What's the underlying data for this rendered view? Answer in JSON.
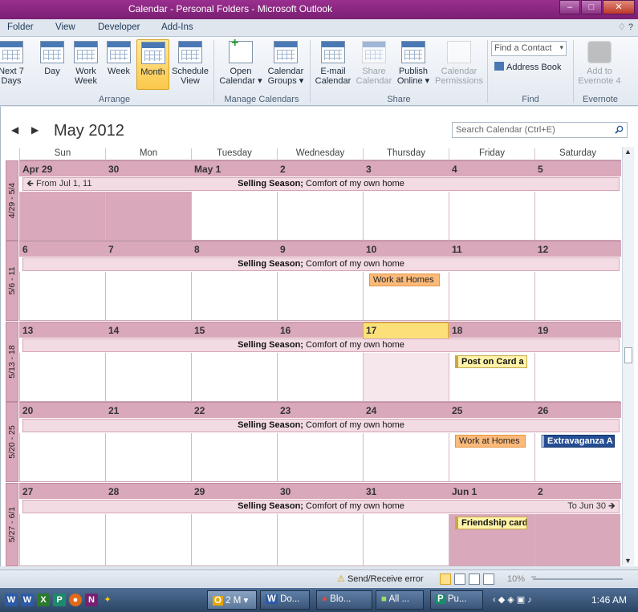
{
  "window": {
    "title": "Calendar - Personal Folders - Microsoft Outlook",
    "min": "–",
    "max": "□",
    "close": "✕"
  },
  "tabs": [
    "Folder",
    "View",
    "Developer",
    "Add-Ins"
  ],
  "tabs_right": "♢ ?",
  "ribbon": {
    "buttons": [
      {
        "label": "Next 7\nDays"
      },
      {
        "label": "Day"
      },
      {
        "label": "Work\nWeek"
      },
      {
        "label": "Week"
      },
      {
        "label": "Month"
      },
      {
        "label": "Schedule\nView"
      },
      {
        "label": "Open\nCalendar ▾"
      },
      {
        "label": "Calendar\nGroups ▾"
      },
      {
        "label": "E-mail\nCalendar"
      },
      {
        "label": "Share\nCalendar"
      },
      {
        "label": "Publish\nOnline ▾"
      },
      {
        "label": "Calendar\nPermissions"
      },
      {
        "label": "Add to\nEvernote 4"
      }
    ],
    "groups": [
      "Arrange",
      "Manage Calendars",
      "Share",
      "Find",
      "Evernote"
    ],
    "find_contact": "Find a Contact",
    "address_book": "Address Book"
  },
  "calendar": {
    "month_title": "May 2012",
    "search_placeholder": "Search Calendar (Ctrl+E)",
    "day_headers": [
      "Sun",
      "Mon",
      "Tuesday",
      "Wednesday",
      "Thursday",
      "Friday",
      "Saturday"
    ],
    "weeks": [
      {
        "label": "4/29 - 5/4",
        "dates": [
          "Apr 29",
          "30",
          "May 1",
          "2",
          "3",
          "4",
          "5"
        ],
        "banner_bold": "Selling Season;",
        "banner_text": " Comfort of my own home",
        "banner_left": "🡸 From Jul 1, 11",
        "banner_right": ""
      },
      {
        "label": "5/6 - 11",
        "dates": [
          "6",
          "7",
          "8",
          "9",
          "10",
          "11",
          "12"
        ],
        "banner_bold": "Selling Season;",
        "banner_text": " Comfort of my own home",
        "banner_left": "",
        "banner_right": ""
      },
      {
        "label": "5/13 - 18",
        "dates": [
          "13",
          "14",
          "15",
          "16",
          "17",
          "18",
          "19"
        ],
        "banner_bold": "Selling Season;",
        "banner_text": " Comfort of my own home",
        "banner_left": "",
        "banner_right": ""
      },
      {
        "label": "5/20 - 25",
        "dates": [
          "20",
          "21",
          "22",
          "23",
          "24",
          "25",
          "26"
        ],
        "banner_bold": "Selling Season;",
        "banner_text": " Comfort of my own home",
        "banner_left": "",
        "banner_right": ""
      },
      {
        "label": "5/27 - 6/1",
        "dates": [
          "27",
          "28",
          "29",
          "30",
          "31",
          "Jun 1",
          "2"
        ],
        "banner_bold": "Selling Season;",
        "banner_text": " Comfort of my own home",
        "banner_left": "",
        "banner_right": "To Jun 30 🡺"
      }
    ],
    "appointments": {
      "w1_thu": "Work at Homes",
      "w2_fri": "Post on Card a",
      "w3_fri": "Work at Homes",
      "w3_sat": "Extravaganza A",
      "w4_fri": "Friendship card"
    }
  },
  "status": {
    "warning": "Send/Receive error",
    "zoom": "10%"
  },
  "taskbar": {
    "tasks": [
      "2 M",
      "Do...",
      "Blo...",
      "All ...",
      "Pu..."
    ],
    "clock": "1:46 AM"
  }
}
